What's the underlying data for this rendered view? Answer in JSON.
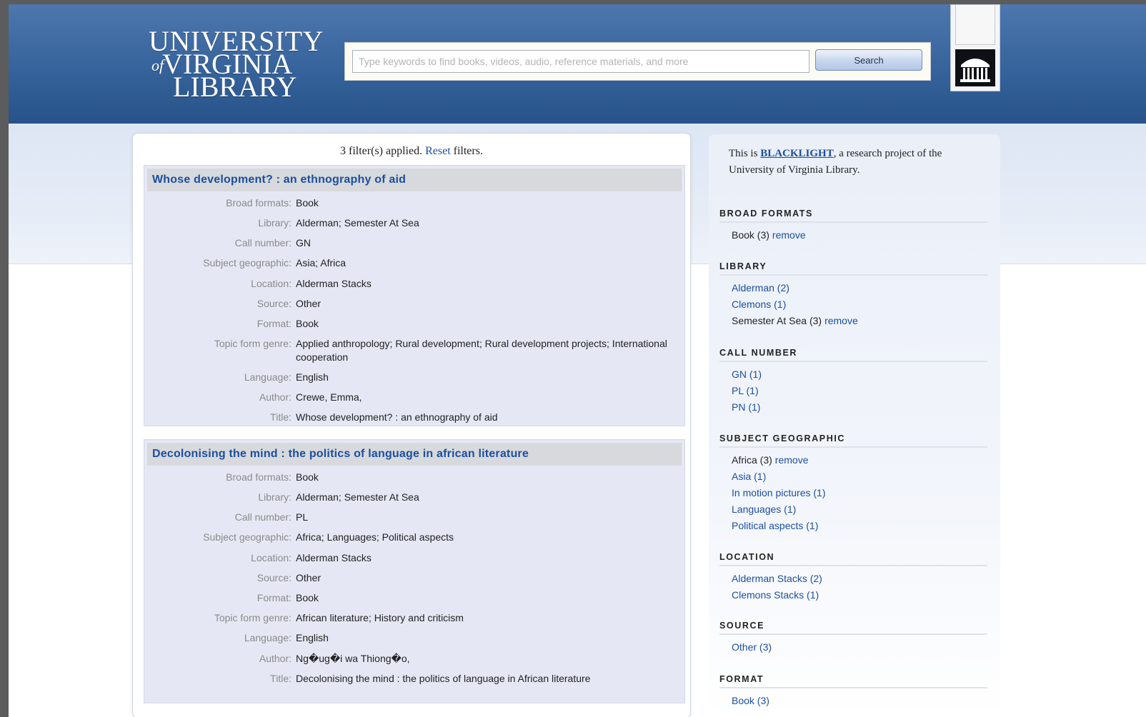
{
  "header": {
    "logo": {
      "line1": "UNIVERSITY",
      "line2": "VIRGINIA",
      "line3": "LIBRARY",
      "of": "of"
    },
    "search": {
      "placeholder": "Type keywords to find books, videos, audio, reference materials, and more",
      "button_label": "Search"
    }
  },
  "results": {
    "filters_count": "3 filter(s) applied.",
    "reset_label": "Reset",
    "filters_tail": "filters.",
    "records": [
      {
        "title": "Whose development? : an ethnography of aid",
        "fields": [
          {
            "label": "Broad formats:",
            "value": "Book"
          },
          {
            "label": "Library:",
            "value": "Alderman; Semester At Sea"
          },
          {
            "label": "Call number:",
            "value": "GN"
          },
          {
            "label": "Subject geographic:",
            "value": "Asia; Africa"
          },
          {
            "label": "Location:",
            "value": "Alderman Stacks"
          },
          {
            "label": "Source:",
            "value": "Other"
          },
          {
            "label": "Format:",
            "value": "Book"
          },
          {
            "label": "Topic form genre:",
            "value": "Applied anthropology; Rural development; Rural development projects; International cooperation"
          },
          {
            "label": "Language:",
            "value": "English"
          },
          {
            "label": "Author:",
            "value": "Crewe, Emma,"
          },
          {
            "label": "Title:",
            "value": "Whose development? : an ethnography of aid"
          }
        ]
      },
      {
        "title": "Decolonising the mind : the politics of language in african literature",
        "fields": [
          {
            "label": "Broad formats:",
            "value": "Book"
          },
          {
            "label": "Library:",
            "value": "Alderman; Semester At Sea"
          },
          {
            "label": "Call number:",
            "value": "PL"
          },
          {
            "label": "Subject geographic:",
            "value": "Africa; Languages; Political aspects"
          },
          {
            "label": "Location:",
            "value": "Alderman Stacks"
          },
          {
            "label": "Source:",
            "value": "Other"
          },
          {
            "label": "Format:",
            "value": "Book"
          },
          {
            "label": "Topic form genre:",
            "value": "African literature; History and criticism"
          },
          {
            "label": "Language:",
            "value": "English"
          },
          {
            "label": "Author:",
            "value": "Ng�ug�i wa Thiong�o,"
          },
          {
            "label": "Title:",
            "value": "Decolonising the mind : the politics of language in African literature"
          }
        ]
      }
    ]
  },
  "sidebar": {
    "intro_pre": "This is",
    "intro_link": "BLACKLIGHT",
    "intro_post": ", a research project of the University of Virginia Library.",
    "facets": [
      {
        "heading": "BROAD FORMATS",
        "items": [
          {
            "text": "Book (3)",
            "selected": true,
            "remove": "remove"
          }
        ]
      },
      {
        "heading": "LIBRARY",
        "items": [
          {
            "text": "Alderman (2)",
            "selected": false
          },
          {
            "text": "Clemons (1)",
            "selected": false
          },
          {
            "text": "Semester At Sea (3)",
            "selected": true,
            "remove": "remove"
          }
        ]
      },
      {
        "heading": "CALL NUMBER",
        "items": [
          {
            "text": "GN (1)",
            "selected": false
          },
          {
            "text": "PL (1)",
            "selected": false
          },
          {
            "text": "PN (1)",
            "selected": false
          }
        ]
      },
      {
        "heading": "SUBJECT GEOGRAPHIC",
        "items": [
          {
            "text": "Africa (3)",
            "selected": true,
            "remove": "remove"
          },
          {
            "text": "Asia (1)",
            "selected": false
          },
          {
            "text": "In motion pictures (1)",
            "selected": false
          },
          {
            "text": "Languages (1)",
            "selected": false
          },
          {
            "text": "Political aspects (1)",
            "selected": false
          }
        ]
      },
      {
        "heading": "LOCATION",
        "items": [
          {
            "text": "Alderman Stacks (2)",
            "selected": false
          },
          {
            "text": "Clemons Stacks (1)",
            "selected": false
          }
        ]
      },
      {
        "heading": "SOURCE",
        "items": [
          {
            "text": "Other (3)",
            "selected": false
          }
        ]
      },
      {
        "heading": "FORMAT",
        "items": [
          {
            "text": "Book (3)",
            "selected": false
          }
        ]
      }
    ]
  }
}
